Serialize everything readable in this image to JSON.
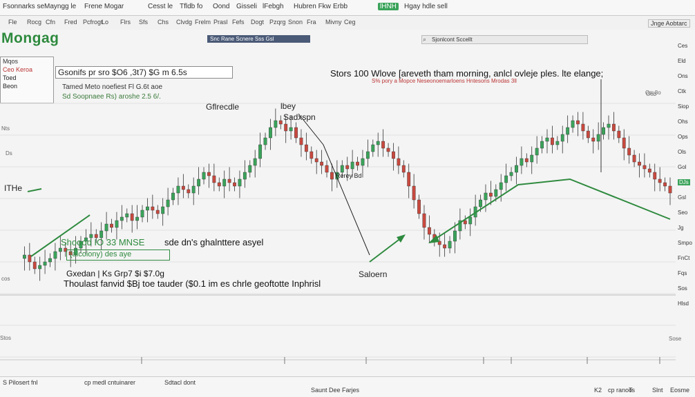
{
  "topbar": {
    "tabs": [
      "Fsonnarks se",
      "Mayngg le",
      "Frene Mogar",
      "Cesst le",
      "Tfldb fo",
      "Oond",
      "Gisseli",
      "lFebgh",
      "Hubren Fkw",
      "Erbb",
      "lHNH",
      "Hgay hdle sell"
    ]
  },
  "toolbar": {
    "items": [
      "Fle",
      "Rocg",
      "Cfn",
      "Fred",
      "Pcfrogt",
      "Lo",
      "Flrs",
      "Sfs",
      "Chs",
      "Clvdg",
      "Frelm",
      "Prasl",
      "Fefs",
      "Dogt",
      "Pzqrg",
      "Snon",
      "Fra",
      "Mivny",
      "Ceg"
    ],
    "search": "Snc Rane Scnere Sss Gsl",
    "symbol_field": "Sjonlcont Sccellt",
    "right_label": "Jnge Aobtarc"
  },
  "app": {
    "logo": "Mongag",
    "info_box": [
      "Mqos",
      "Ceo Keroa",
      "Toed",
      "Beon"
    ],
    "price_line": "Gsonifs pr sro $O6 ,3t7) $G m 6.5s",
    "sub_line_1": "Tamed Meto noefiest Fl G.6t aoe",
    "sub_line_2": "Sd Soopnaee Rs) aroshe 2.5 6/."
  },
  "chart_header": {
    "headline": "Stors 100 Wlove [areveth tham morning, anlcl ovleje ples. lte elange;",
    "subtitle": "S% pory a Mopce Neseonoemarloens Hntesons Mrodas 3ll"
  },
  "y_labels": [
    "Orr 8o",
    "Nts",
    "Ds",
    "Stos",
    "cos",
    "Gob",
    "Sose"
  ],
  "right_panel": [
    "Ces",
    "Eld",
    "Ons",
    "Ctk",
    "Siop",
    "Ohs",
    "Ops",
    "Ols",
    "Gol",
    "DJs",
    "Gsl",
    "Seo",
    "Jg",
    "Smpo",
    "FnCt",
    "Fqs",
    "Sos",
    "Hlsd"
  ],
  "right_panel_highlights": [
    "Ol",
    "DJs"
  ],
  "chart_annotations": {
    "peak_label": "Gflrecdle",
    "resistance": "lbey",
    "support_top": "Sadxspn",
    "mid_label": "Rerey Bd",
    "support_bottom": "Saloern",
    "left_marker": "ITHe",
    "green_note_1": "Shoood IO 33 MNSE",
    "green_note_1b": "sde dn's ghalnttere asyel",
    "green_box": "(alcoiony) des aye",
    "green_note_2": "Gxedan | Ks Grp7 $i $7.0g",
    "bottom_note": "Thoulast fanvid $Bj toe tauder ($0.1 im es chrle geoftotte Inphrisl"
  },
  "statusbar": {
    "items": [
      "S Pilosert fnl",
      "cp medl cntuinarer",
      "Sdtacl dont",
      "Saunt Dee Farjes",
      "K2",
      "cp ranoo",
      "Ts",
      "Slnt",
      "Eosme"
    ]
  },
  "colors": {
    "up": "#3aa35a",
    "down": "#c8493f",
    "accent": "#2e8a3e"
  },
  "chart_data": {
    "type": "candlestick",
    "x": [],
    "series": [
      {
        "name": "",
        "values": [
          45,
          46,
          44,
          42,
          43,
          44,
          45,
          47,
          48,
          47,
          46,
          48,
          50,
          51,
          52,
          51,
          53,
          55,
          54,
          56,
          57,
          58,
          56,
          57,
          59,
          60,
          59,
          58,
          60,
          62,
          64,
          66,
          65,
          64,
          66,
          68,
          70,
          69,
          67,
          66,
          68,
          67,
          66,
          68,
          70,
          72,
          74,
          78,
          80,
          83,
          85,
          84,
          82,
          83,
          80,
          78,
          76,
          74,
          73,
          72,
          70,
          68,
          70,
          72,
          71,
          73,
          72,
          74,
          76,
          78,
          79,
          77,
          76,
          74,
          72,
          70,
          66,
          62,
          58,
          54,
          52,
          50,
          49,
          48,
          50,
          53,
          56,
          55,
          57,
          60,
          62,
          64,
          63,
          65,
          67,
          69,
          70,
          72,
          74,
          73,
          75,
          77,
          79,
          80,
          78,
          79,
          81,
          83,
          85,
          84,
          82,
          80,
          79,
          81,
          83,
          84,
          82,
          80,
          77,
          75,
          73,
          72,
          71,
          70,
          68,
          67,
          66,
          64
        ]
      }
    ]
  }
}
